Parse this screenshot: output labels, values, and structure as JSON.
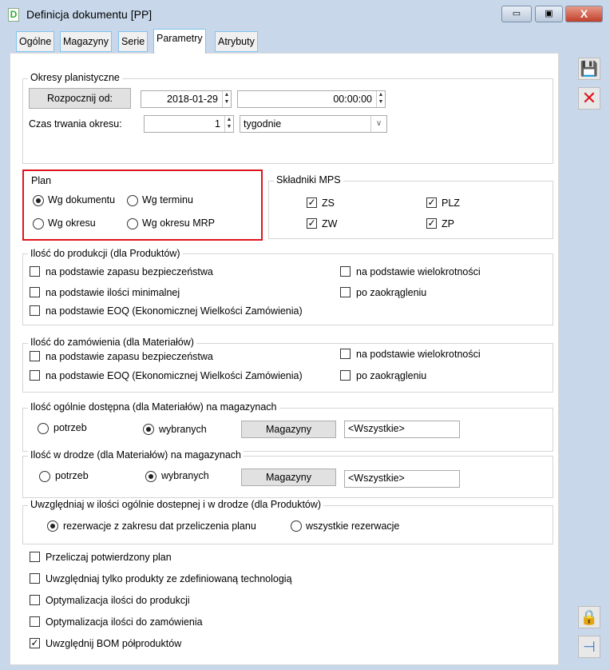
{
  "window": {
    "title": "Definicja dokumentu [PP]",
    "icon": "D",
    "minimize": "▭",
    "maximize": "▣",
    "close": "X"
  },
  "tabs": [
    "Ogólne",
    "Magazyny",
    "Serie",
    "Parametry",
    "Atrybuty"
  ],
  "okresy": {
    "legend": "Okresy planistyczne",
    "start_button": "Rozpocznij od:",
    "date": "2018-01-29",
    "time": "00:00:00",
    "duration_label": "Czas trwania okresu:",
    "duration": "1",
    "unit": "tygodnie"
  },
  "plan": {
    "legend": "Plan",
    "options": [
      "Wg dokumentu",
      "Wg terminu",
      "Wg okresu",
      "Wg okresu MRP"
    ],
    "selected": 0
  },
  "mps": {
    "legend": "Składniki MPS",
    "items": [
      {
        "label": "ZS",
        "checked": true
      },
      {
        "label": "PLZ",
        "checked": true
      },
      {
        "label": "ZW",
        "checked": true
      },
      {
        "label": "ZP",
        "checked": true
      }
    ]
  },
  "produkcja": {
    "legend": "Ilość do produkcji (dla Produktów)",
    "items": [
      "na podstawie zapasu bezpieczeństwa",
      "na podstawie ilości minimalnej",
      "na podstawie EOQ (Ekonomicznej Wielkości Zamówienia)",
      "na podstawie wielokrotności",
      "po zaokrągleniu"
    ]
  },
  "zamowienie": {
    "legend": "Ilość do zamówienia (dla Materiałów)",
    "items": [
      "na podstawie zapasu bezpieczeństwa",
      "na podstawie EOQ (Ekonomicznej Wielkości Zamówienia)",
      "na podstawie wielokrotności",
      "po zaokrągleniu"
    ]
  },
  "dostepna": {
    "legend": "Ilość ogólnie dostępna (dla Materiałów) na magazynach",
    "options": [
      "potrzeb",
      "wybranych"
    ],
    "selected": 1,
    "button": "Magazyny",
    "value": "<Wszystkie>"
  },
  "droga": {
    "legend": "Ilość w drodze (dla Materiałów) na magazynach",
    "options": [
      "potrzeb",
      "wybranych"
    ],
    "selected": 1,
    "button": "Magazyny",
    "value": "<Wszystkie>"
  },
  "uwzgl": {
    "legend": "Uwzględniaj w ilości ogólnie dostepnej i w drodze (dla Produktów)",
    "options": [
      "rezerwacje z zakresu dat przeliczenia planu",
      "wszystkie rezerwacje"
    ],
    "selected": 0
  },
  "options": [
    {
      "label": "Przeliczaj potwierdzony plan",
      "checked": false
    },
    {
      "label": "Uwzględniaj tylko produkty ze zdefiniowaną technologią",
      "checked": false
    },
    {
      "label": "Optymalizacja ilości do produkcji",
      "checked": false
    },
    {
      "label": "Optymalizacja ilości do zamówienia",
      "checked": false
    },
    {
      "label": "Uwzględnij BOM półproduktów",
      "checked": true
    }
  ],
  "colors": {
    "highlight": "#e0141e"
  }
}
